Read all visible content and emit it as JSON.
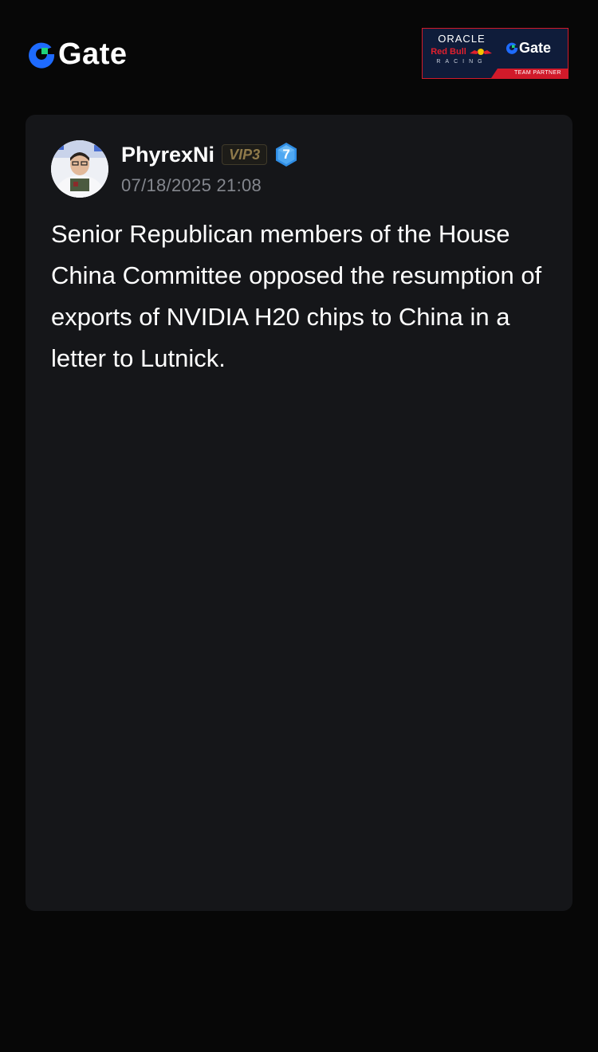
{
  "header": {
    "brand_name": "Gate",
    "partner": {
      "oracle_text": "ORACLE",
      "red_bull_text": "Red Bull",
      "racing_text": "RACING",
      "gate_text": "Gate",
      "footer_text": "TEAM PARTNER"
    }
  },
  "post": {
    "author": "PhyrexNi",
    "vip_label": "VIP3",
    "level": "7",
    "timestamp": "07/18/2025 21:08",
    "body": "Senior Republican members of the House China Committee opposed the resumption of exports of NVIDIA H20 chips to China in a letter to Lutnick."
  },
  "colors": {
    "page_background": "#070707",
    "card_background": "#151619",
    "brand_blue": "#1e6bff",
    "brand_green": "#1fd37a",
    "partner_red": "#d11a2a",
    "partner_navy": "#0f1c3a",
    "vip_gold": "#8f7a4a",
    "level_blue": "#2f8de4",
    "timestamp_gray": "#84878e"
  },
  "icons": {
    "brand_logo": "gate-logo-icon",
    "level_badge": "hexagon-level-icon",
    "bull_mark": "red-bull-icon"
  }
}
